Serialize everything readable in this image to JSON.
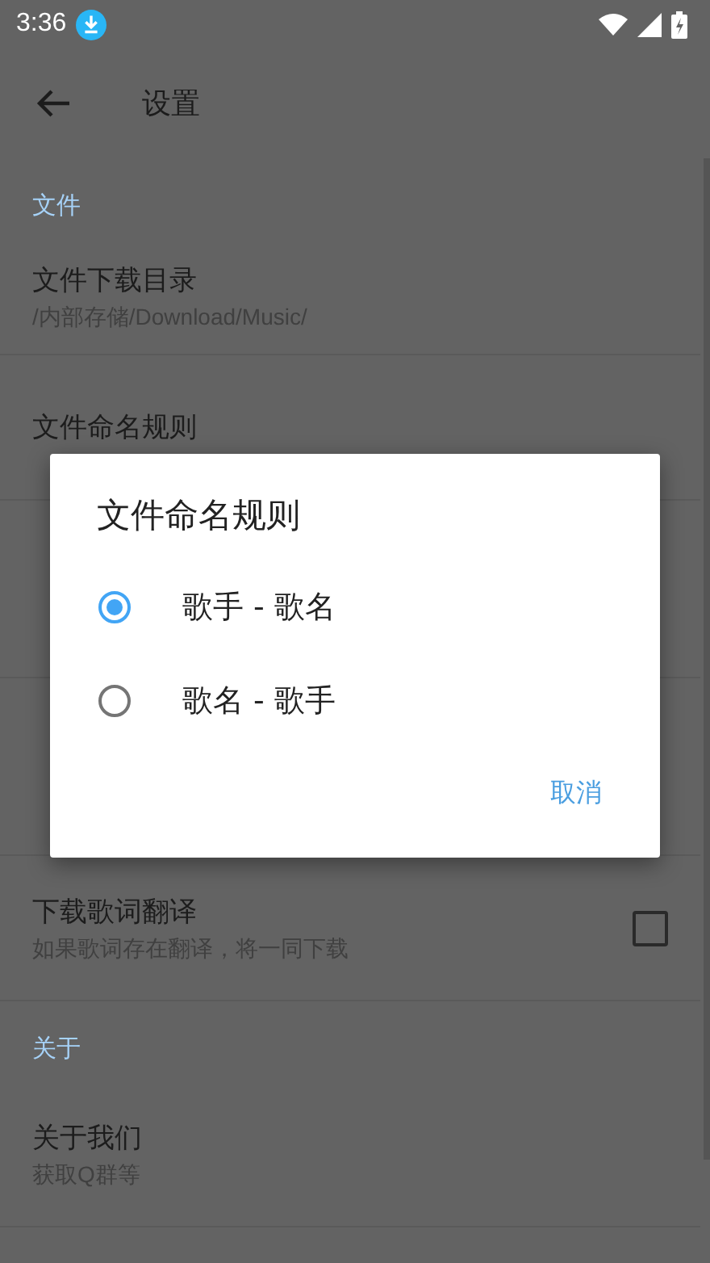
{
  "status_bar": {
    "time": "3:36"
  },
  "toolbar": {
    "title": "设置"
  },
  "sections": [
    {
      "header": "文件",
      "items": [
        {
          "kind": "text",
          "title": "文件下载目录",
          "subtitle": "/内部存储/Download/Music/"
        },
        {
          "kind": "text",
          "title": "文件命名规则"
        },
        {
          "kind": "covered"
        },
        {
          "kind": "covered"
        },
        {
          "kind": "checkbox",
          "title": "下载歌词翻译",
          "subtitle": "如果歌词存在翻译，将一同下载",
          "checked": false
        }
      ]
    },
    {
      "header": "关于",
      "items": [
        {
          "kind": "text",
          "title": "关于我们",
          "subtitle": "获取Q群等"
        }
      ]
    }
  ],
  "dialog": {
    "title": "文件命名规则",
    "options": [
      {
        "label": "歌手 - 歌名",
        "selected": true
      },
      {
        "label": "歌名 - 歌手",
        "selected": false
      }
    ],
    "buttons": [
      "取消"
    ]
  }
}
